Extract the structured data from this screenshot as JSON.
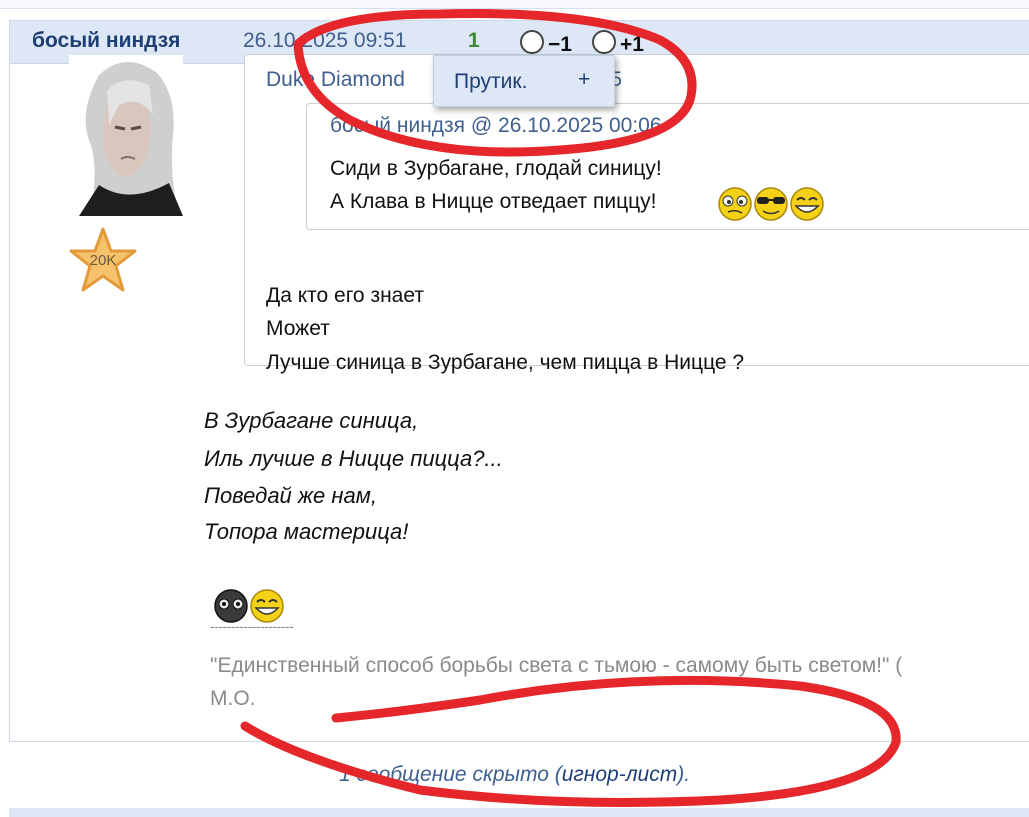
{
  "post": {
    "author": "босый ниндзя",
    "date": "26.10.2025 09:51",
    "rating": "1",
    "vote_minus_label": "−1",
    "vote_plus_label": "+1",
    "badge_label": "20K"
  },
  "popup": {
    "label": "Прутик.",
    "plus": "+"
  },
  "outer_quote": {
    "author_visible": "Duke Diamond",
    "time_fragment": ":35",
    "lines": [
      "Да кто его знает",
      "Может",
      "Лучше синица в Зурбагане, чем пицца в Ницце ?"
    ]
  },
  "inner_quote": {
    "header": "босый ниндзя @ 26.10.2025 00:06",
    "lines": [
      "Сиди в Зурбагане, глодай синицу!",
      "А Клава в Ницце отведает пиццу!"
    ]
  },
  "poem": [
    "В Зурбагане синица,",
    "Иль лучше в Ницце пицца?...",
    "Поведай же нам,",
    "Топора мастерица!"
  ],
  "signature": {
    "dashes": "--------------------",
    "quote": "\"Единственный способ борьбы света с тьмою - самому быть светом!\" (",
    "author": "М.О."
  },
  "hidden": {
    "prefix": "1 сообщение скрыто (",
    "link": "игнор-лист",
    "suffix": ")."
  },
  "colors": {
    "header_bg": "#dde7f5",
    "author": "#1e3f74",
    "link": "#3f5f8f",
    "rating_green": "#3b8a2e",
    "marker_red": "#e5262b"
  }
}
